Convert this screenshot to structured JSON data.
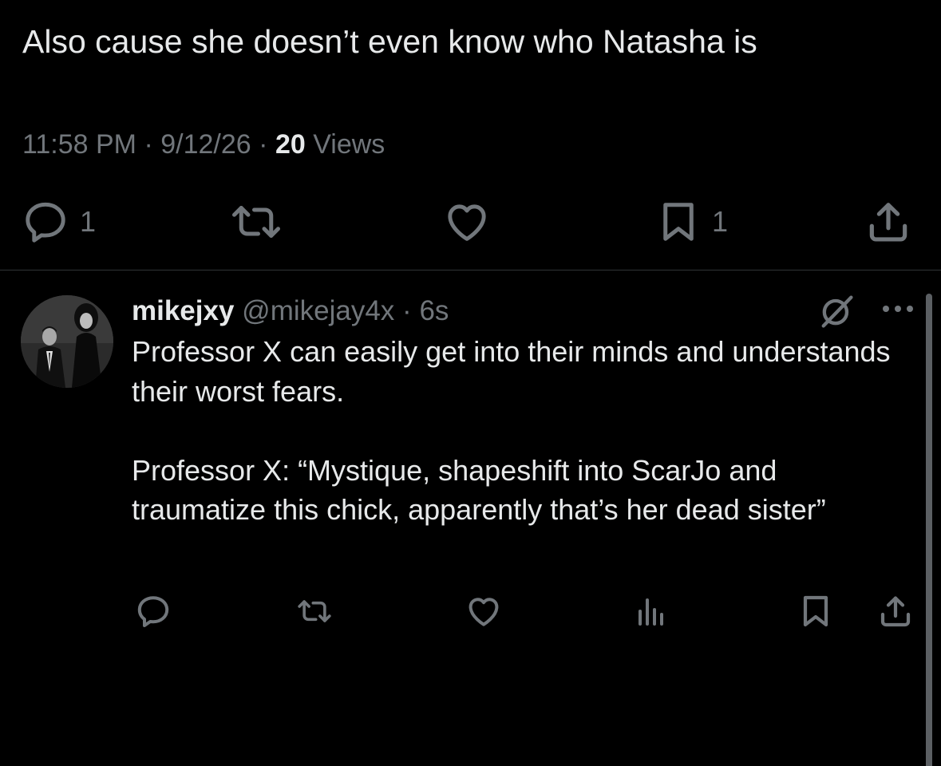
{
  "tweet": {
    "text": "Also cause she doesn’t even know who Natasha is",
    "time": "11:58 PM",
    "date": "9/12/26",
    "views_count": "20",
    "views_label": "Views",
    "separator": "·",
    "actions": {
      "reply_count": "1",
      "bookmark_count": "1"
    }
  },
  "reply": {
    "display_name": "mikejxy",
    "handle": "@mikejay4x",
    "separator": "·",
    "age": "6s",
    "paragraph1": "Professor X can easily get into their minds and understands their worst fears.",
    "paragraph2": "Professor X: “Mystique, shapeshift into ScarJo and traumatize this chick, apparently that’s her dead sister”"
  },
  "icons": {
    "reply": "speech-bubble-icon",
    "retweet": "retweet-arrows-icon",
    "like": "heart-icon",
    "bookmark": "bookmark-icon",
    "share": "share-upload-icon",
    "views": "bar-chart-icon",
    "grok": "grok-slash-icon",
    "more": "ellipsis-icon"
  },
  "colors": {
    "background": "#000000",
    "text": "#e7e9ea",
    "muted": "#71767b",
    "divider": "#2f3336"
  }
}
